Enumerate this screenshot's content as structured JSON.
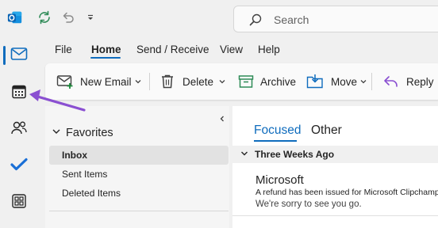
{
  "titlebar": {
    "search_placeholder": "Search",
    "icons": [
      "outlook-logo-icon",
      "sync-icon",
      "undo-icon",
      "customize-qat-icon"
    ]
  },
  "left_rail": {
    "items": [
      {
        "name": "mail",
        "active": true
      },
      {
        "name": "calendar",
        "active": false
      },
      {
        "name": "people",
        "active": false
      },
      {
        "name": "to-do",
        "active": false
      },
      {
        "name": "apps",
        "active": false
      }
    ]
  },
  "menu": {
    "items": [
      "File",
      "Home",
      "Send / Receive",
      "View",
      "Help"
    ],
    "active": "Home"
  },
  "ribbon": {
    "new_email": "New Email",
    "delete": "Delete",
    "archive": "Archive",
    "move": "Move",
    "reply": "Reply"
  },
  "folders": {
    "favorites_label": "Favorites",
    "items": [
      {
        "label": "Inbox",
        "selected": true
      },
      {
        "label": "Sent Items",
        "selected": false
      },
      {
        "label": "Deleted Items",
        "selected": false
      }
    ]
  },
  "mail": {
    "tabs": [
      "Focused",
      "Other"
    ],
    "active_tab": "Focused",
    "group_header": "Three Weeks Ago",
    "message": {
      "sender": "Microsoft",
      "subject": "A refund has been issued for Microsoft Clipchamp",
      "preview": "We're sorry to see you go."
    }
  },
  "colors": {
    "accent": "#0f6cbd",
    "annotation_arrow": "#8a4fd1",
    "app_background": "#f0f0f0"
  }
}
